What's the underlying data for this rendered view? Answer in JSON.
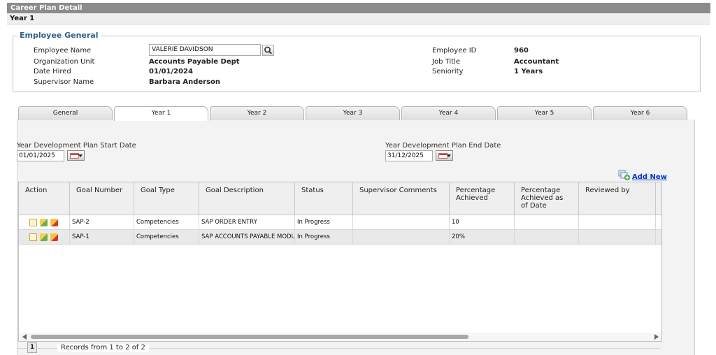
{
  "window": {
    "title": "Career Plan Detail",
    "subtitle": "Year 1"
  },
  "employee": {
    "legend": "Employee General",
    "name_label": "Employee Name",
    "name_value": "VALERIE DAVIDSON",
    "org_label": "Organization Unit",
    "org_value": "Accounts Payable Dept",
    "hired_label": "Date Hired",
    "hired_value": "01/01/2024",
    "supervisor_label": "Supervisor Name",
    "supervisor_value": "Barbara Anderson",
    "id_label": "Employee ID",
    "id_value": "960",
    "job_label": "Job Title",
    "job_value": "Accountant",
    "seniority_label": "Seniority",
    "seniority_value": "1 Years"
  },
  "tabs": [
    "General",
    "Year 1",
    "Year 2",
    "Year 3",
    "Year 4",
    "Year 5",
    "Year 6"
  ],
  "active_tab": "Year 1",
  "plan": {
    "start_label": "Year Development Plan Start Date",
    "start_value": "01/01/2025",
    "end_label": "Year Development Plan End Date",
    "end_value": "31/12/2025",
    "add_new": "Add New"
  },
  "grid": {
    "headers": [
      "Action",
      "Goal Number",
      "Goal Type",
      "Goal Description",
      "Status",
      "Supervisor Comments",
      "Percentage Achieved",
      "Percentage Achieved as of Date",
      "Reviewed by"
    ],
    "rows": [
      {
        "goal_number": "SAP-2",
        "goal_type": "Competencies",
        "description": "SAP ORDER ENTRY",
        "status": "In Progress",
        "comments": "",
        "pct": "10",
        "pct_date": "",
        "reviewed_by": ""
      },
      {
        "goal_number": "SAP-1",
        "goal_type": "Competencies",
        "description": "SAP ACCOUNTS PAYABLE MODUL",
        "status": "In Progress",
        "comments": "",
        "pct": "20%",
        "pct_date": "",
        "reviewed_by": ""
      }
    ]
  },
  "pager": {
    "page": "1",
    "records": "Records from 1 to 2 of 2"
  },
  "colors": {
    "title_bar": "#8c8c8c",
    "legend": "#2f5f8a",
    "link": "#0033cc"
  }
}
